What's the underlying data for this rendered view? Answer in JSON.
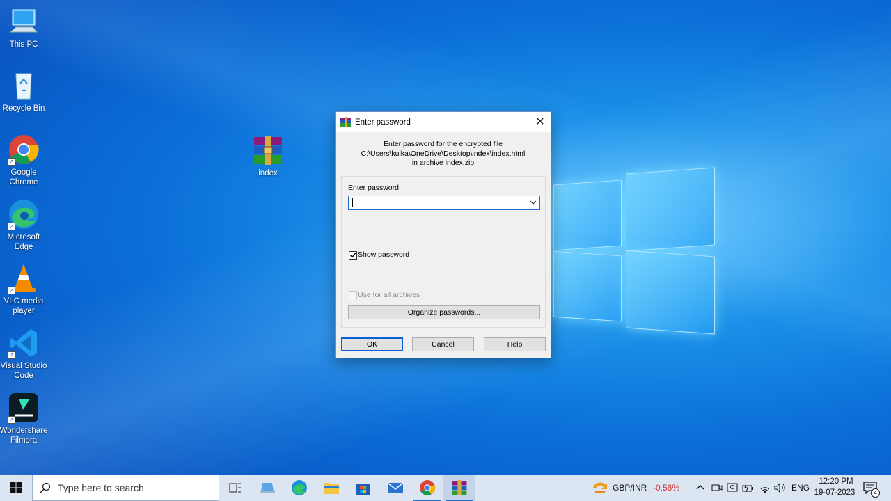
{
  "desktop": {
    "icons": [
      {
        "label": "This PC"
      },
      {
        "label": "Recycle Bin"
      },
      {
        "label": "Google Chrome"
      },
      {
        "label": "Microsoft Edge"
      },
      {
        "label": "VLC media player"
      },
      {
        "label": "Visual Studio Code"
      },
      {
        "label": "Wondershare Filmora"
      },
      {
        "label": "index"
      }
    ]
  },
  "dialog": {
    "title": "Enter password",
    "info_line1": "Enter password for the encrypted file",
    "info_line2": "C:\\Users\\kulka\\OneDrive\\Desktop\\index\\index.html",
    "info_line3": "in archive index.zip",
    "password_label": "Enter password",
    "password_value": "",
    "show_password_label": "Show password",
    "show_password_checked": true,
    "use_all_label": "Use for all archives",
    "use_all_checked": false,
    "organize_label": "Organize passwords...",
    "ok_label": "OK",
    "cancel_label": "Cancel",
    "help_label": "Help"
  },
  "taskbar": {
    "search_placeholder": "Type here to search",
    "ticker_label": "GBP/INR",
    "ticker_change": "-0.56%",
    "language": "ENG",
    "time": "12:20 PM",
    "date": "19-07-2023",
    "notification_count": "4"
  },
  "colors": {
    "accent": "#0a63d6",
    "negative": "#d13438"
  }
}
